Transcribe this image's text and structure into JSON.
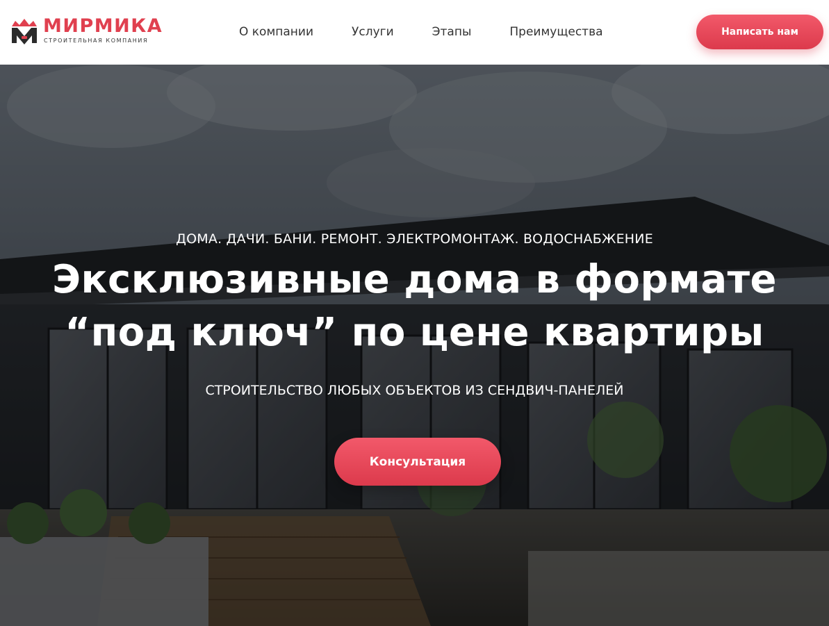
{
  "brand": {
    "name": "МИРМИКА",
    "tagline": "СТРОИТЕЛЬНАЯ КОМПАНИЯ",
    "logo_icon": "crown-m-logo-icon",
    "accent_color": "#e0404f"
  },
  "nav": {
    "items": [
      {
        "label": "О компании"
      },
      {
        "label": "Услуги"
      },
      {
        "label": "Этапы"
      },
      {
        "label": "Преимущества"
      }
    ]
  },
  "header": {
    "cta_label": "Написать нам"
  },
  "hero": {
    "kicker": "ДОМА. ДАЧИ. БАНИ. РЕМОНТ. ЭЛЕКТРОМОНТАЖ. ВОДОСНАБЖЕНИЕ",
    "title_line1": "Эксклюзивные дома в формате",
    "title_line2": "“под ключ” по цене квартиры",
    "subtitle": "СТРОИТЕЛЬСТВО ЛЮБЫХ ОБЪЕКТОВ ИЗ СЕНДВИЧ-ПАНЕЛЕЙ",
    "cta_label": "Консультация",
    "background": "modern-house-photo"
  }
}
